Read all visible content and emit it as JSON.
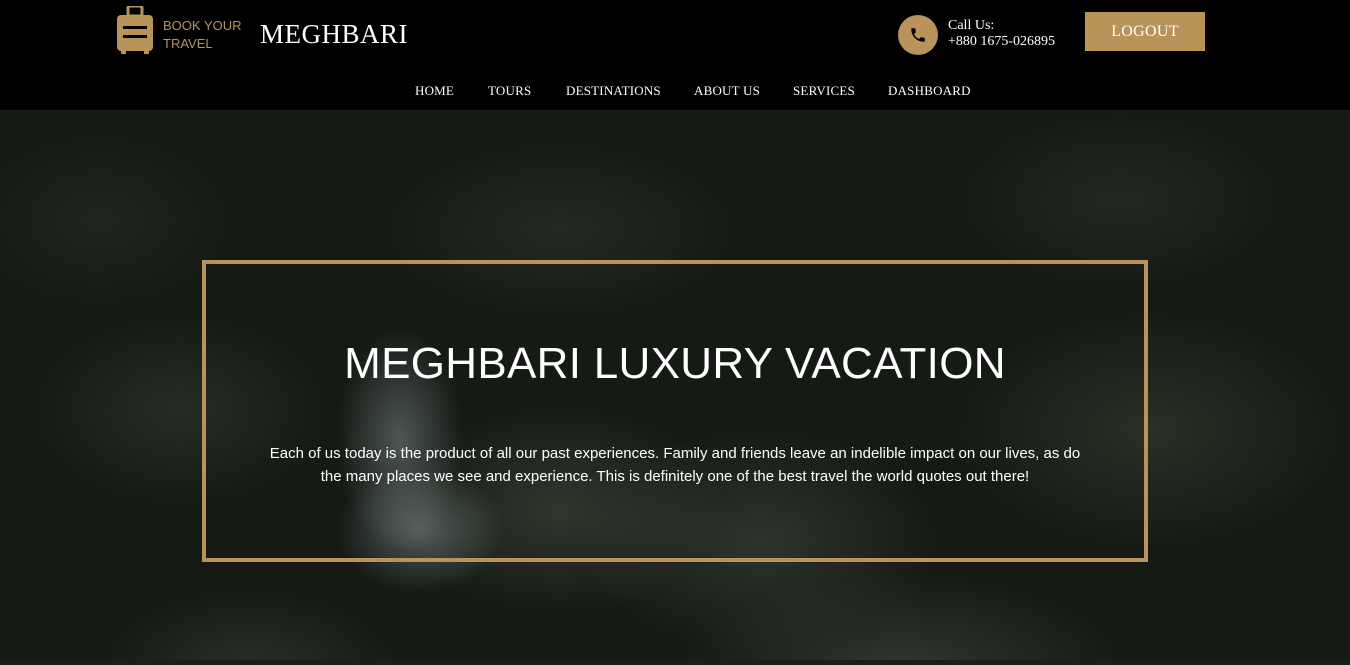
{
  "header": {
    "brand_tagline": "BOOK YOUR TRAVEL",
    "brand_name": "MEGHBARI",
    "call_label": "Call Us:",
    "call_number": "+880 1675-026895",
    "logout_label": "LOGOUT"
  },
  "nav": {
    "items": [
      "HOME",
      "TOURS",
      "DESTINATIONS",
      "ABOUT US",
      "SERVICES",
      "DASHBOARD"
    ]
  },
  "hero": {
    "title": "MEGHBARI LUXURY VACATION",
    "text": "Each of us today is the product of all our past experiences. Family and friends leave an indelible impact on our lives, as do the many places we see and experience. This is definitely one of the best travel the world quotes out there!"
  },
  "icons": {
    "brand": "suitcase-icon",
    "call": "phone-icon"
  },
  "colors": {
    "accent": "#b8935a",
    "background": "#000000",
    "text": "#ffffff"
  }
}
